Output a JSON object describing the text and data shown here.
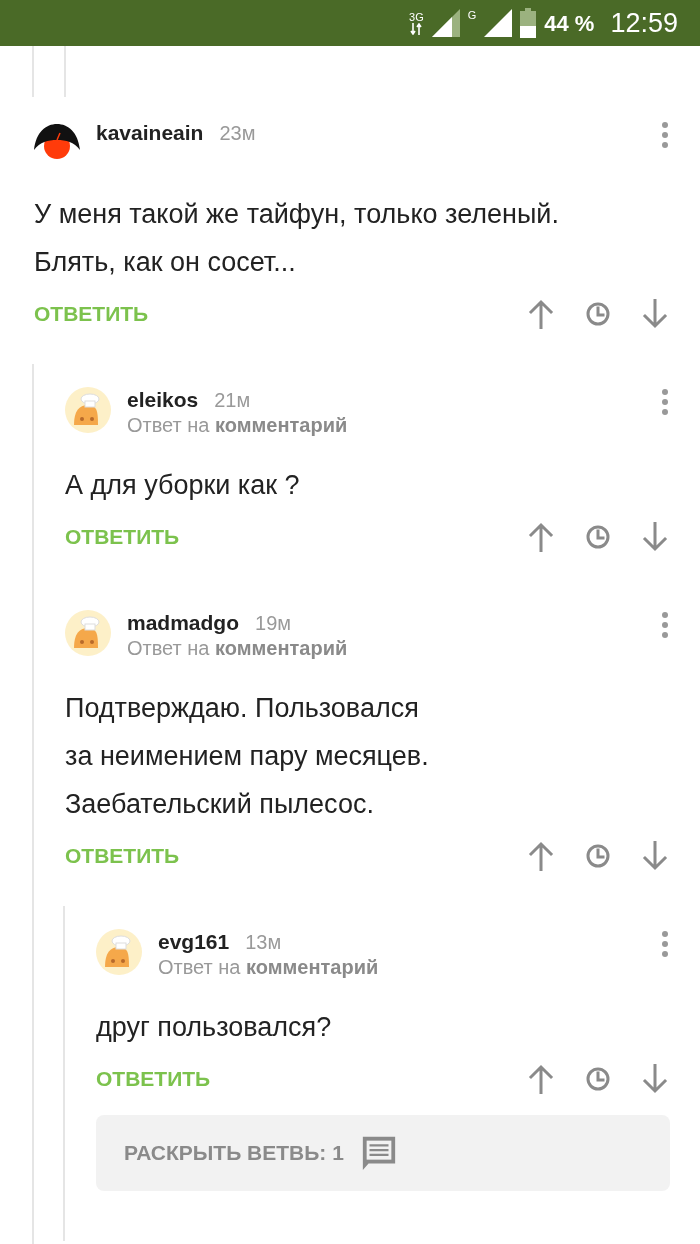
{
  "status_bar": {
    "network_1": "3G",
    "network_2": "G",
    "battery_text": "44 %",
    "time": "12:59"
  },
  "comments": [
    {
      "author": "kavaineain",
      "time": "23м",
      "avatar": {
        "kind": "dark"
      },
      "text": "У меня такой же тайфун, только зеленый.\nБлять, как он сосет...",
      "reply_label": "ОТВЕТИТЬ",
      "children": [
        {
          "author": "eleikos",
          "time": "21м",
          "avatar": {
            "kind": "chef"
          },
          "reply_to": "Ответ на **комментарий**",
          "text": "А для уборки как ?",
          "reply_label": "ОТВЕТИТЬ"
        },
        {
          "author": "madmadgo",
          "time": "19м",
          "avatar": {
            "kind": "chef"
          },
          "reply_to": "Ответ на **комментарий**",
          "text": "Подтверждаю. Пользовался\nза неимением пару месяцев.\nЗаебательский пылесос.",
          "reply_label": "ОТВЕТИТЬ",
          "children": [
            {
              "author": "evg161",
              "time": "13м",
              "avatar": {
                "kind": "chef"
              },
              "reply_to": "Ответ на **комментарий**",
              "text": "друг пользовался?",
              "reply_label": "ОТВЕТИТЬ",
              "expand_thread": "РАСКРЫТЬ ВЕТВЬ: 1"
            }
          ]
        }
      ]
    }
  ]
}
